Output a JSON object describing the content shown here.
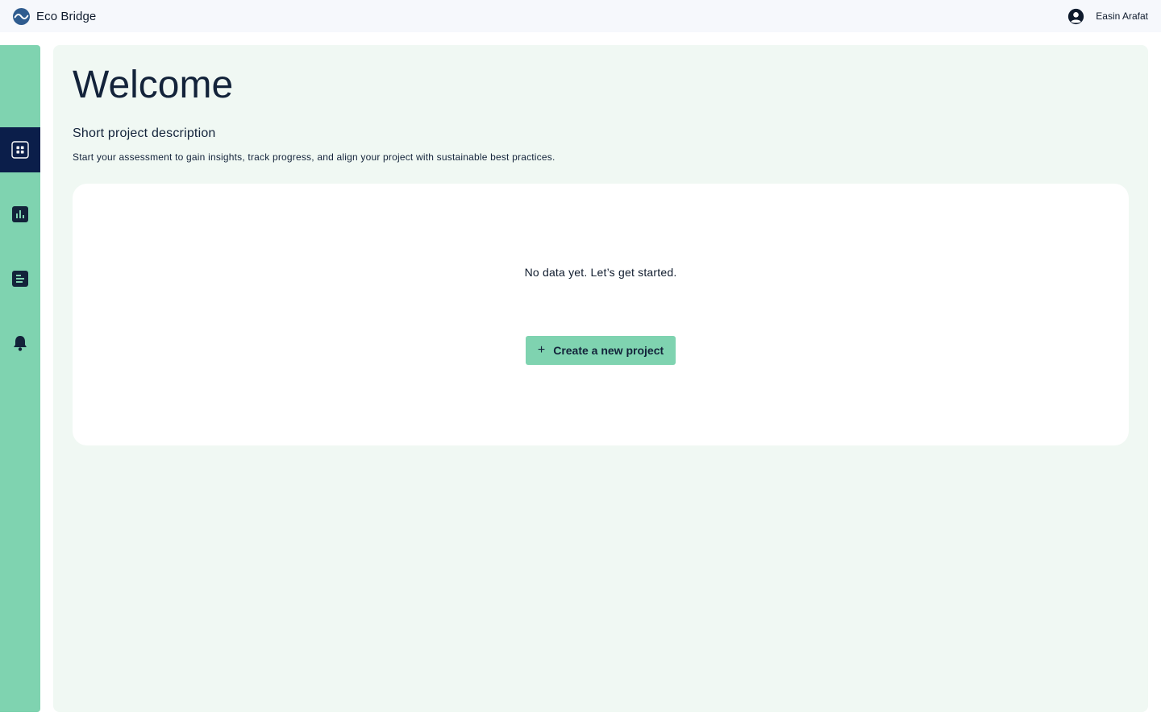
{
  "app": {
    "name": "Eco Bridge",
    "logo_icon": "eco-bridge-wave-logo"
  },
  "user": {
    "name": "Easin Arafat",
    "avatar_icon": "user-circle-icon"
  },
  "sidebar": {
    "items": [
      {
        "id": "dashboard",
        "icon": "grid-icon",
        "active": true
      },
      {
        "id": "analytics",
        "icon": "bar-chart-icon",
        "active": false
      },
      {
        "id": "documents",
        "icon": "document-list-icon",
        "active": false
      },
      {
        "id": "notifications",
        "icon": "bell-icon",
        "active": false
      }
    ]
  },
  "main": {
    "title": "Welcome",
    "subtitle": "Short project description",
    "description": "Start your assessment to gain insights, track progress, and align your project with sustainable best practices.",
    "empty_state": {
      "message": "No data yet. Let’s get started.",
      "button_icon": "+",
      "button_label": "Create a new project"
    }
  },
  "colors": {
    "sidebar": "#7fd3b0",
    "sidebar_active": "#0b1e4a",
    "panel_bg": "#f0f8f3",
    "accent": "#7fd3b0",
    "text": "#13233a"
  }
}
